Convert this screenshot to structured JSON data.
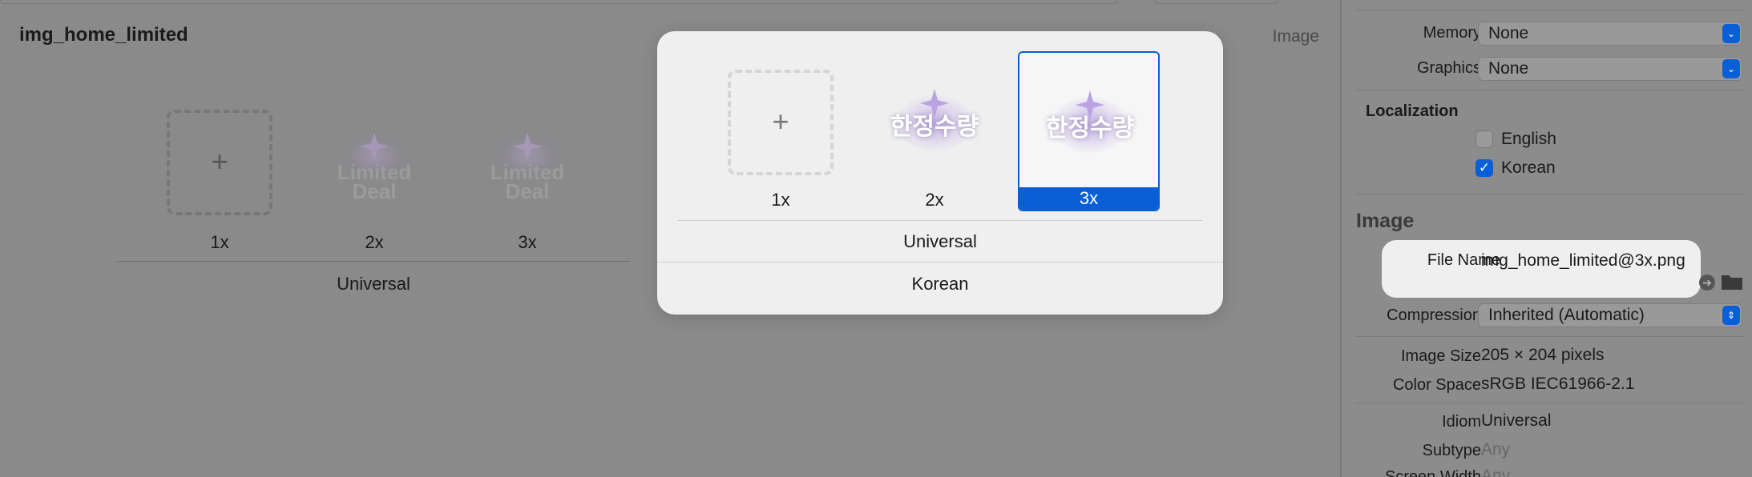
{
  "editor": {
    "asset_name": "img_home_limited",
    "type_label": "Image",
    "slots": [
      {
        "label": "1x",
        "empty_icon": "+"
      },
      {
        "label": "2x",
        "thumb_text_line1": "Limited",
        "thumb_text_line2": "Deal"
      },
      {
        "label": "3x",
        "thumb_text_line1": "Limited",
        "thumb_text_line2": "Deal"
      }
    ],
    "group_label": "Universal"
  },
  "popover": {
    "slots": [
      {
        "label": "1x",
        "empty_icon": "+"
      },
      {
        "label": "2x",
        "thumb_text": "한정수량"
      },
      {
        "label": "3x",
        "thumb_text": "한정수량"
      }
    ],
    "selected": "3x",
    "group_label": "Universal",
    "locale_label": "Korean"
  },
  "inspector": {
    "memory_label": "Memory",
    "memory_value": "None",
    "graphics_label": "Graphics",
    "graphics_value": "None",
    "localization_heading": "Localization",
    "languages": [
      {
        "name": "English",
        "checked": false
      },
      {
        "name": "Korean",
        "checked": true
      }
    ],
    "image_heading": "Image",
    "file_name_label": "File Name",
    "file_name_value": "img_home_limited@3x.png",
    "compression_label": "Compression",
    "compression_value": "Inherited (Automatic)",
    "image_size_label": "Image Size",
    "image_size_value": "205 × 204 pixels",
    "color_space_label": "Color Space",
    "color_space_value": "sRGB IEC61966-2.1",
    "idiom_label": "Idiom",
    "idiom_value": "Universal",
    "subtype_label": "Subtype",
    "subtype_value": "Any",
    "screen_width_label": "Screen Width",
    "screen_width_value": "Any"
  },
  "colors": {
    "accent": "#0a5fd6",
    "dim_background": "#8a8a8a",
    "popover_background": "#efefef"
  }
}
